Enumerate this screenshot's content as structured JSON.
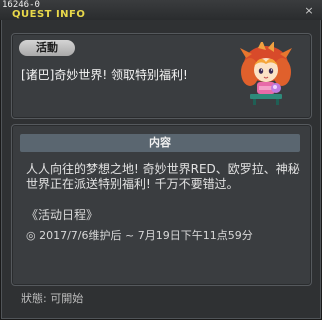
{
  "window": {
    "id": "16246-0",
    "title": "QUEST INFO"
  },
  "event": {
    "badge": "活動",
    "title": "[诸巴]奇妙世界! 领取特别福利!"
  },
  "content": {
    "header": "内容",
    "line1": "人人向往的梦想之地! 奇妙世界RED、欧罗拉、神秘",
    "line2": "世界正在派送特别福利! 千万不要错过。",
    "schedule_title": "《活动日程》",
    "schedule_time": "◎ 2017/7/6维护后 ~ 7月19日下午11点59分"
  },
  "status": {
    "text": "狀態: 可開始"
  },
  "colors": {
    "title_text": "#e8d84a",
    "panel_bg": "#3a3d40",
    "header_bg": "#5a6670"
  },
  "icons": [
    "close-icon",
    "npc-avatar"
  ]
}
